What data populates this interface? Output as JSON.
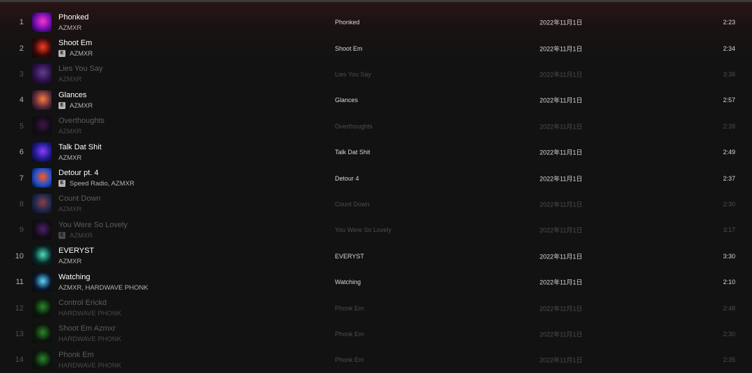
{
  "tracks": [
    {
      "num": "1",
      "title": "Phonked",
      "artists": "AZMXR",
      "explicit": false,
      "album": "Phonked",
      "date": "2022年11月1日",
      "duration": "2:23",
      "dim": false,
      "art": [
        "#6a0dad",
        "#ff33cc"
      ]
    },
    {
      "num": "2",
      "title": "Shoot Em",
      "artists": "AZMXR",
      "explicit": true,
      "album": "Shoot Em",
      "date": "2022年11月1日",
      "duration": "2:34",
      "dim": false,
      "art": [
        "#3a0a0a",
        "#ff3b1f"
      ]
    },
    {
      "num": "3",
      "title": "Lies You Say",
      "artists": "AZMXR",
      "explicit": false,
      "album": "Lies You Say",
      "date": "2022年11月1日",
      "duration": "3:38",
      "dim": true,
      "art": [
        "#4b0f8a",
        "#b06cff"
      ]
    },
    {
      "num": "4",
      "title": "Glances",
      "artists": "AZMXR",
      "explicit": true,
      "album": "Glances",
      "date": "2022年11月1日",
      "duration": "2:57",
      "dim": false,
      "art": [
        "#5a2a3a",
        "#ff7a3d"
      ]
    },
    {
      "num": "5",
      "title": "Overthoughts",
      "artists": "AZMXR",
      "explicit": false,
      "album": "Overthoughts",
      "date": "2022年11月1日",
      "duration": "2:39",
      "dim": true,
      "art": [
        "#120618",
        "#6a1a7a"
      ]
    },
    {
      "num": "6",
      "title": "Talk Dat Shit",
      "artists": "AZMXR",
      "explicit": false,
      "album": "Talk Dat Shit",
      "date": "2022年11月1日",
      "duration": "2:49",
      "dim": false,
      "art": [
        "#1c1a8a",
        "#8a3dff"
      ]
    },
    {
      "num": "7",
      "title": "Detour pt. 4",
      "artists": "Speed Radio, AZMXR",
      "explicit": true,
      "album": "Detour 4",
      "date": "2022年11月1日",
      "duration": "2:37",
      "dim": false,
      "art": [
        "#1f4fd1",
        "#ff5a1f"
      ]
    },
    {
      "num": "8",
      "title": "Count Down",
      "artists": "AZMXR",
      "explicit": false,
      "album": "Count Down",
      "date": "2022年11月1日",
      "duration": "2:30",
      "dim": true,
      "art": [
        "#2b3a8a",
        "#ff6f7a"
      ]
    },
    {
      "num": "9",
      "title": "You Were So Lovely",
      "artists": "AZMXR",
      "explicit": true,
      "album": "You Were So Lovely",
      "date": "2022年11月1日",
      "duration": "3:17",
      "dim": true,
      "art": [
        "#100818",
        "#8a2ad1"
      ]
    },
    {
      "num": "10",
      "title": "EVERYST",
      "artists": "AZMXR",
      "explicit": false,
      "album": "EVERYST",
      "date": "2022年11月1日",
      "duration": "3:30",
      "dim": false,
      "art": [
        "#0a2a2a",
        "#4de0c0"
      ]
    },
    {
      "num": "11",
      "title": "Watching",
      "artists": "AZMXR, HARDWAVE PHONK",
      "explicit": false,
      "album": "Watching",
      "date": "2022年11月1日",
      "duration": "2:10",
      "dim": false,
      "art": [
        "#0a1830",
        "#5ad8ff"
      ]
    },
    {
      "num": "12",
      "title": "Control Erickd",
      "artists": "HARDWAVE PHONK",
      "explicit": false,
      "album": "Phonk Em",
      "date": "2022年11月1日",
      "duration": "2:48",
      "dim": true,
      "art": [
        "#061a06",
        "#3dff3d"
      ]
    },
    {
      "num": "13",
      "title": "Shoot Em Azmxr",
      "artists": "HARDWAVE PHONK",
      "explicit": false,
      "album": "Phonk Em",
      "date": "2022年11月1日",
      "duration": "2:30",
      "dim": true,
      "art": [
        "#061a06",
        "#3dff3d"
      ]
    },
    {
      "num": "14",
      "title": "Phonk Em",
      "artists": "HARDWAVE PHONK",
      "explicit": false,
      "album": "Phonk Em",
      "date": "2022年11月1日",
      "duration": "2:35",
      "dim": true,
      "art": [
        "#061a06",
        "#3dff3d"
      ]
    }
  ],
  "explicit_badge": "E",
  "colors": {
    "background": "#121212",
    "header_tint": "#2a1416",
    "active_text": "#ffffff",
    "dimmed_text": "#5d5d5d"
  }
}
